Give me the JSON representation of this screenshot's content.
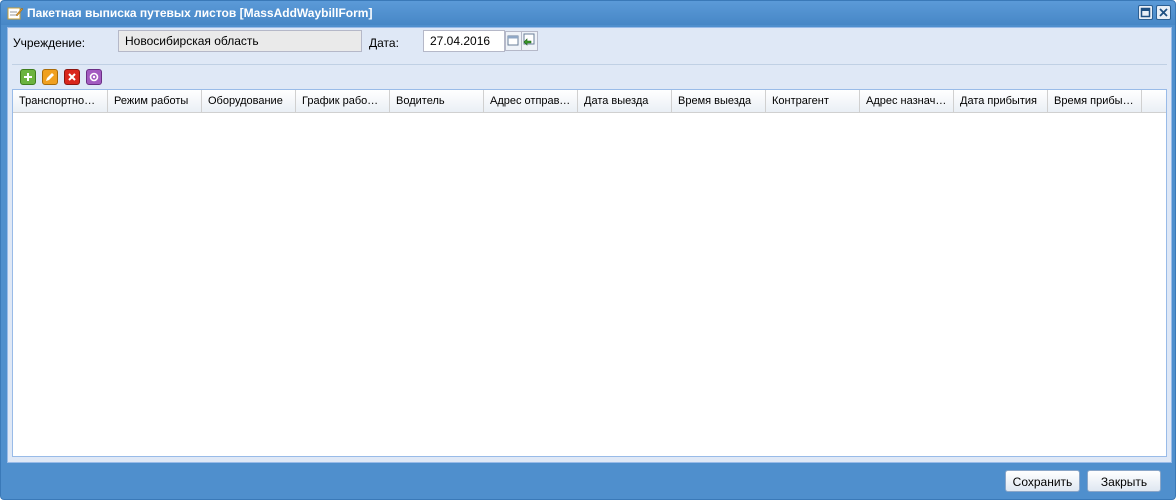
{
  "window": {
    "title": "Пакетная выписка путевых листов [MassAddWaybillForm]"
  },
  "form": {
    "institution_label": "Учреждение:",
    "institution_value": "Новосибирская область",
    "date_label": "Дата:",
    "date_value": "27.04.2016"
  },
  "toolbar": {
    "icons": [
      "add-icon",
      "edit-icon",
      "delete-icon",
      "settings-icon"
    ],
    "colors": {
      "add": "#6cb33f",
      "edit": "#f0a020",
      "delete": "#d9261c",
      "settings": "#a35bc0"
    }
  },
  "grid": {
    "columns": [
      "Транспортное ...",
      "Режим работы",
      "Оборудование",
      "График рабоче...",
      "Водитель",
      "Адрес отправл...",
      "Дата выезда",
      "Время выезда",
      "Контрагент",
      "Адрес назначе...",
      "Дата прибытия",
      "Время прибытия"
    ],
    "rows": []
  },
  "footer": {
    "save_label": "Сохранить",
    "close_label": "Закрыть"
  }
}
